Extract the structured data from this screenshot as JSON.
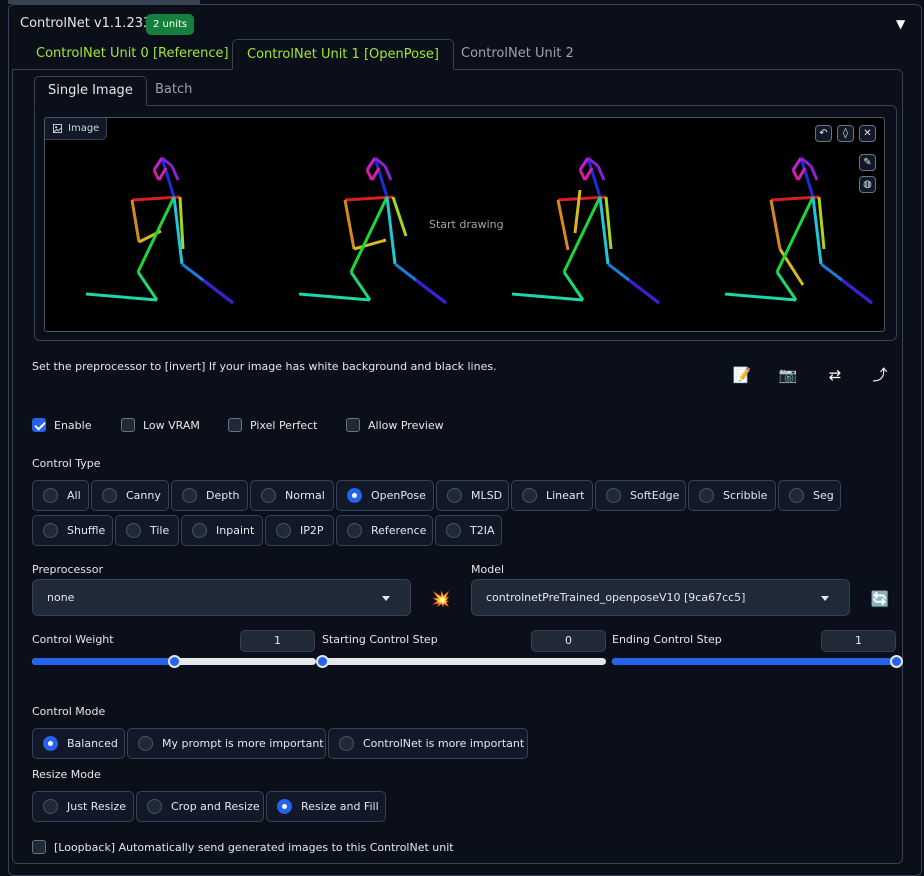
{
  "header": {
    "title": "ControlNet v1.1.233",
    "badge": "2 units",
    "collapse_icon": "▼"
  },
  "unit_tabs": [
    "ControlNet Unit 0 [Reference]",
    "ControlNet Unit 1 [OpenPose]",
    "ControlNet Unit 2"
  ],
  "image_tabs": [
    "Single Image",
    "Batch"
  ],
  "image": {
    "label": "Image",
    "placeholder": "Start drawing"
  },
  "hint": "Set the preprocessor to [invert] If your image has white background and black lines.",
  "checkboxes": [
    {
      "label": "Enable",
      "checked": true
    },
    {
      "label": "Low VRAM",
      "checked": false
    },
    {
      "label": "Pixel Perfect",
      "checked": false
    },
    {
      "label": "Allow Preview",
      "checked": false
    }
  ],
  "control_type": {
    "label": "Control Type",
    "options": [
      "All",
      "Canny",
      "Depth",
      "Normal",
      "OpenPose",
      "MLSD",
      "Lineart",
      "SoftEdge",
      "Scribble",
      "Seg",
      "Shuffle",
      "Tile",
      "Inpaint",
      "IP2P",
      "Reference",
      "T2IA"
    ],
    "selected": "OpenPose"
  },
  "preprocessor": {
    "label": "Preprocessor",
    "value": "none"
  },
  "model": {
    "label": "Model",
    "value": "controlnetPreTrained_openposeV10 [9ca67cc5]"
  },
  "sliders": [
    {
      "label": "Control Weight",
      "value": "1",
      "fraction": 0.5
    },
    {
      "label": "Starting Control Step",
      "value": "0",
      "fraction": 0.0
    },
    {
      "label": "Ending Control Step",
      "value": "1",
      "fraction": 1.0
    }
  ],
  "control_mode": {
    "label": "Control Mode",
    "options": [
      "Balanced",
      "My prompt is more important",
      "ControlNet is more important"
    ],
    "selected": "Balanced"
  },
  "resize_mode": {
    "label": "Resize Mode",
    "options": [
      "Just Resize",
      "Crop and Resize",
      "Resize and Fill"
    ],
    "selected": "Resize and Fill"
  },
  "loopback": {
    "label": "[Loopback] Automatically send generated images to this ControlNet unit",
    "checked": false
  },
  "icons": {
    "run": "💥",
    "refresh": "🔄",
    "edit": "📝",
    "camera": "📷",
    "swap": "⇄",
    "send": "⤴"
  },
  "colors": {
    "accent": "#2563eb",
    "badge": "#15803d",
    "active_tab": "#a3e635"
  }
}
